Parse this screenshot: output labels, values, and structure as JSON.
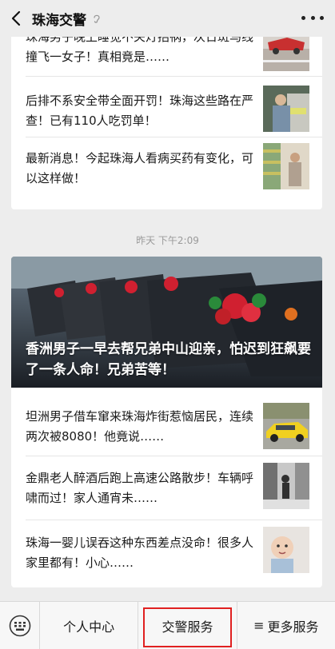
{
  "header": {
    "title": "珠海交警"
  },
  "articles_top": [
    {
      "title": "珠海男子晚上睡觉不关灯招祸，次日斑马线撞飞一女子！真相竟是……"
    },
    {
      "title": "后排不系安全带全面开罚！珠海这些路在严查！已有110人吃罚单！"
    },
    {
      "title": "最新消息！今起珠海人看病买药有变化，可以这样做！"
    }
  ],
  "timestamp": "昨天 下午2:09",
  "hero": {
    "title": "香洲男子一早去帮兄弟中山迎亲，怕迟到狂飙要了一条人命！兄弟苦等！"
  },
  "articles_bottom": [
    {
      "title": "坦洲男子借车窜来珠海炸街惹恼居民，连续两次被8080！他竟说……"
    },
    {
      "title": "金鼎老人醉酒后跑上高速公路散步！车辆呼啸而过！家人通宵未……"
    },
    {
      "title": "珠海一婴儿误吞这种东西差点没命！很多人家里都有！小心……"
    }
  ],
  "bottom_menu": {
    "item1": "个人中心",
    "item2": "交警服务",
    "item3": "更多服务",
    "menu_icon": "≡"
  },
  "colors": {
    "highlight_box": "#e02020",
    "background": "#ededed"
  },
  "icons": [
    "back-arrow-icon",
    "ear-icon",
    "more-dots-icon",
    "keyboard-icon"
  ]
}
